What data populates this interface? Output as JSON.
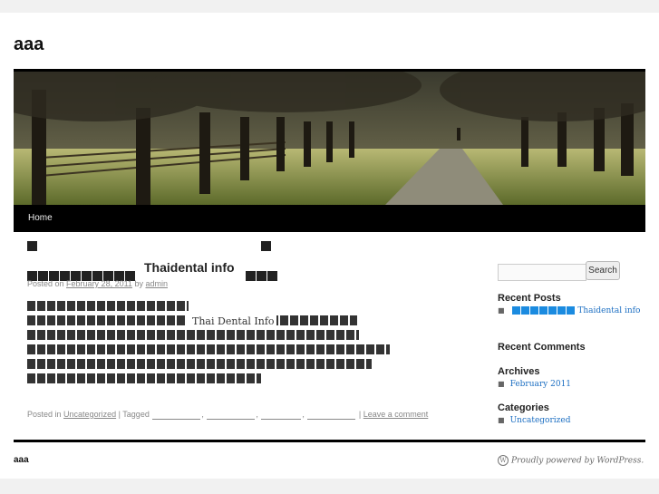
{
  "site": {
    "title": "aaa"
  },
  "nav": {
    "home": "Home"
  },
  "post": {
    "title": "Thaidental info",
    "meta": {
      "posted_on": "Posted on",
      "date": "February 28, 2011",
      "by": "by",
      "author": "admin"
    },
    "inline_label": "Thai Dental Info",
    "utility": {
      "posted_in": "Posted in",
      "category": "Uncategorized",
      "tagged": "Tagged",
      "separator": "|",
      "leave_comment": "Leave a comment"
    }
  },
  "sidebar": {
    "search_button": "Search",
    "search_placeholder": "",
    "recent_posts_title": "Recent Posts",
    "recent_post_link": "Thaidental info",
    "recent_comments_title": "Recent Comments",
    "archives_title": "Archives",
    "archive_link": "February 2011",
    "categories_title": "Categories",
    "category_link": "Uncategorized"
  },
  "footer": {
    "site_info": "aaa",
    "generator": "Proudly powered by WordPress."
  },
  "colors": {
    "link_blue": "#1b6ec2",
    "nav_bg": "#000000"
  },
  "icons": {
    "wordpress": "wordpress-icon"
  }
}
